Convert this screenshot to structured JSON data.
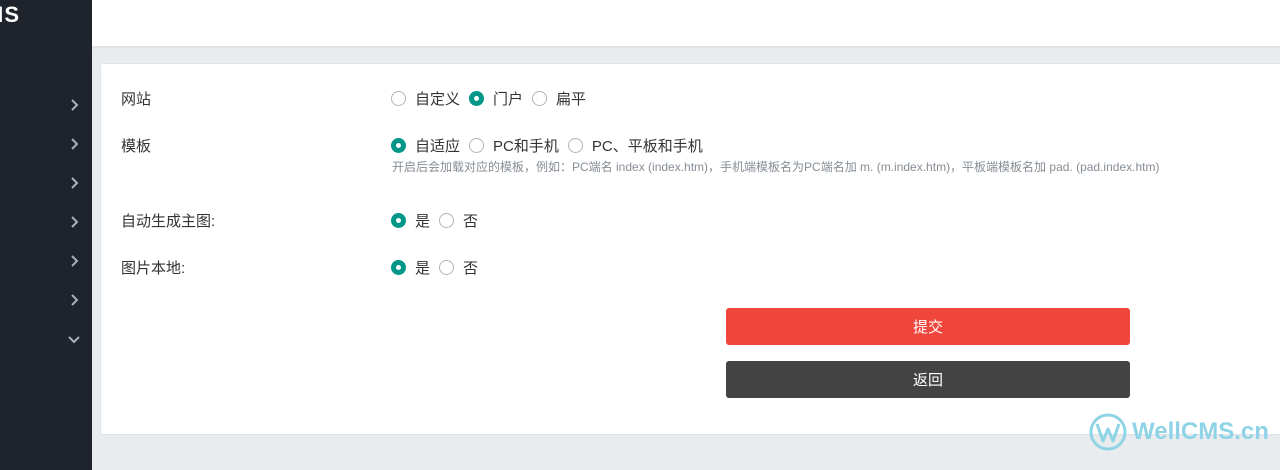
{
  "sidebar": {
    "brand": "WellCMS",
    "nav": [
      {
        "icon": "chevron-right-icon"
      },
      {
        "icon": "chevron-right-icon"
      },
      {
        "icon": "chevron-right-icon"
      },
      {
        "icon": "chevron-right-icon"
      },
      {
        "icon": "chevron-right-icon"
      },
      {
        "icon": "chevron-right-icon"
      },
      {
        "icon": "chevron-down-icon"
      }
    ]
  },
  "form": {
    "website": {
      "label": "网站",
      "options": [
        "自定义",
        "门户",
        "扁平"
      ],
      "selected": "门户"
    },
    "template": {
      "label": "模板",
      "options": [
        "自适应",
        "PC和手机",
        "PC、平板和手机"
      ],
      "selected": "自适应",
      "help": "开启后会加载对应的模板，例如：PC端名 index (index.htm)，手机端模板名为PC端名加 m. (m.index.htm)，平板端模板名加 pad. (pad.index.htm)"
    },
    "auto_thumb": {
      "label": "自动生成主图:",
      "options": [
        "是",
        "否"
      ],
      "selected": "是"
    },
    "local_images": {
      "label": "图片本地:",
      "options": [
        "是",
        "否"
      ],
      "selected": "是"
    },
    "submit_label": "提交",
    "back_label": "返回"
  },
  "watermark": {
    "text": "WellCMS.cn"
  },
  "colors": {
    "accent": "#009688",
    "submit": "#f0463c",
    "back": "#434343",
    "sidebar": "#1f232c"
  }
}
